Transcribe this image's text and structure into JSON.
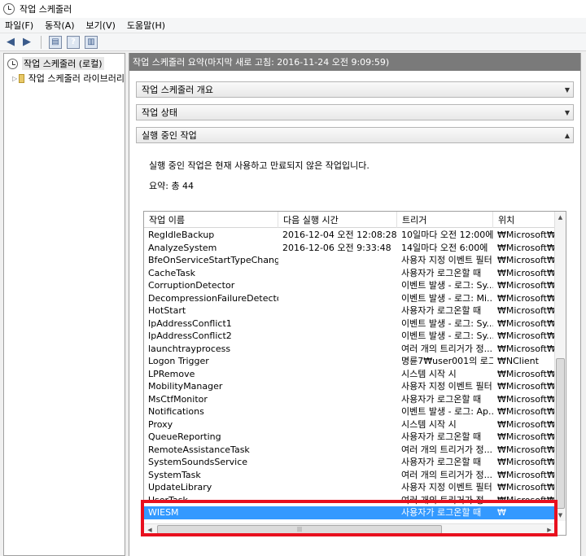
{
  "window": {
    "title": "작업 스케줄러"
  },
  "menu": [
    "파일(F)",
    "동작(A)",
    "보기(V)",
    "도움말(H)"
  ],
  "toolbar": {
    "icons": [
      "back-arrow-icon",
      "forward-arrow-icon",
      "console-icon",
      "help-icon",
      "panel-icon"
    ]
  },
  "tree": {
    "root": "작업 스케줄러 (로컬)",
    "child": "작업 스케줄러 라이브러리"
  },
  "summary": {
    "header": "작업 스케줄러 요약(마지막 새로 고침: 2016-11-24 오전 9:09:59)"
  },
  "sections": {
    "overview": "작업 스케줄러 개요",
    "status": "작업 상태",
    "running": "실행 중인 작업"
  },
  "running": {
    "description": "실행 중인 작업은 현재 사용하고 만료되지 않은 작업입니다.",
    "total": "요약: 총 44"
  },
  "table": {
    "columns": [
      "작업 이름",
      "다음 실행 시간",
      "트리거",
      "위치"
    ],
    "rows": [
      [
        "RegIdleBackup",
        "2016-12-04 오전 12:08:28",
        "10일마다 오전 12:00에",
        "₩Microsoft₩Wir"
      ],
      [
        "AnalyzeSystem",
        "2016-12-06 오전 9:33:48",
        "14일마다 오전 6:00에",
        "₩Microsoft₩Wir"
      ],
      [
        "BfeOnServiceStartTypeChange",
        "",
        "사용자 지정 이벤트 필터",
        "₩Microsoft₩Wir"
      ],
      [
        "CacheTask",
        "",
        "사용자가 로그온할 때",
        "₩Microsoft₩Wir"
      ],
      [
        "CorruptionDetector",
        "",
        "이벤트 발생 - 로그: Sy...",
        "₩Microsoft₩Wir"
      ],
      [
        "DecompressionFailureDetector",
        "",
        "이벤트 발생 - 로그: Mi...",
        "₩Microsoft₩Wir"
      ],
      [
        "HotStart",
        "",
        "사용자가 로그온할 때",
        "₩Microsoft₩Wir"
      ],
      [
        "IpAddressConflict1",
        "",
        "이벤트 발생 - 로그: Sy...",
        "₩Microsoft₩Wir"
      ],
      [
        "IpAddressConflict2",
        "",
        "이벤트 발생 - 로그: Sy...",
        "₩Microsoft₩Wir"
      ],
      [
        "launchtrayprocess",
        "",
        "여러 개의 트리거가 정...",
        "₩Microsoft₩Wir"
      ],
      [
        "Logon Trigger",
        "",
        "명륜7₩user001의 로그...",
        "₩NClient"
      ],
      [
        "LPRemove",
        "",
        "시스템 시작 시",
        "₩Microsoft₩Wir"
      ],
      [
        "MobilityManager",
        "",
        "사용자 지정 이벤트 필터",
        "₩Microsoft₩Wir"
      ],
      [
        "MsCtfMonitor",
        "",
        "사용자가 로그온할 때",
        "₩Microsoft₩Wir"
      ],
      [
        "Notifications",
        "",
        "이벤트 발생 - 로그: Ap...",
        "₩Microsoft₩Wir"
      ],
      [
        "Proxy",
        "",
        "시스템 시작 시",
        "₩Microsoft₩Wir"
      ],
      [
        "QueueReporting",
        "",
        "사용자가 로그온할 때",
        "₩Microsoft₩Wir"
      ],
      [
        "RemoteAssistanceTask",
        "",
        "여러 개의 트리거가 정...",
        "₩Microsoft₩Wir"
      ],
      [
        "SystemSoundsService",
        "",
        "사용자가 로그온할 때",
        "₩Microsoft₩Wir"
      ],
      [
        "SystemTask",
        "",
        "여러 개의 트리거가 정...",
        "₩Microsoft₩Wir"
      ],
      [
        "UpdateLibrary",
        "",
        "사용자 지정 이벤트 필터",
        "₩Microsoft₩Wir"
      ],
      [
        "UserTask",
        "",
        "여러 개의 트리거가 정...",
        "₩Microsoft₩Wir"
      ],
      [
        "WIESM",
        "",
        "사용자가 로그온할 때",
        "₩"
      ]
    ],
    "selected_row": "WIESM"
  },
  "colors": {
    "selection": "#3399ff",
    "highlight_box": "#e8101e",
    "summary_header": "#7a7a7a"
  }
}
